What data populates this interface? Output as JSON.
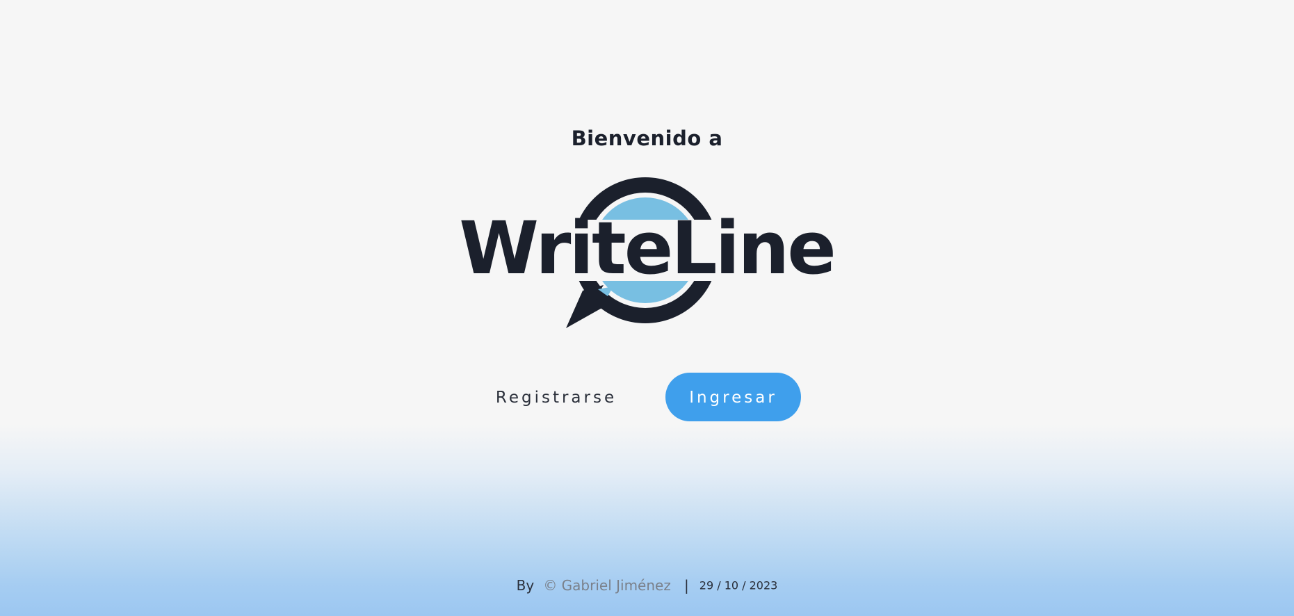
{
  "header": {
    "welcome": "Bienvenido a"
  },
  "logo": {
    "text": "WriteLine",
    "colors": {
      "dark": "#1b202c",
      "bubble": "#78bfe2"
    }
  },
  "actions": {
    "register_label": "Registrarse",
    "login_label": "Ingresar",
    "login_color": "#3f9fec"
  },
  "footer": {
    "by": "By",
    "author": "© Gabriel Jiménez",
    "separator": "|",
    "date": "29 / 10 / 2023"
  }
}
